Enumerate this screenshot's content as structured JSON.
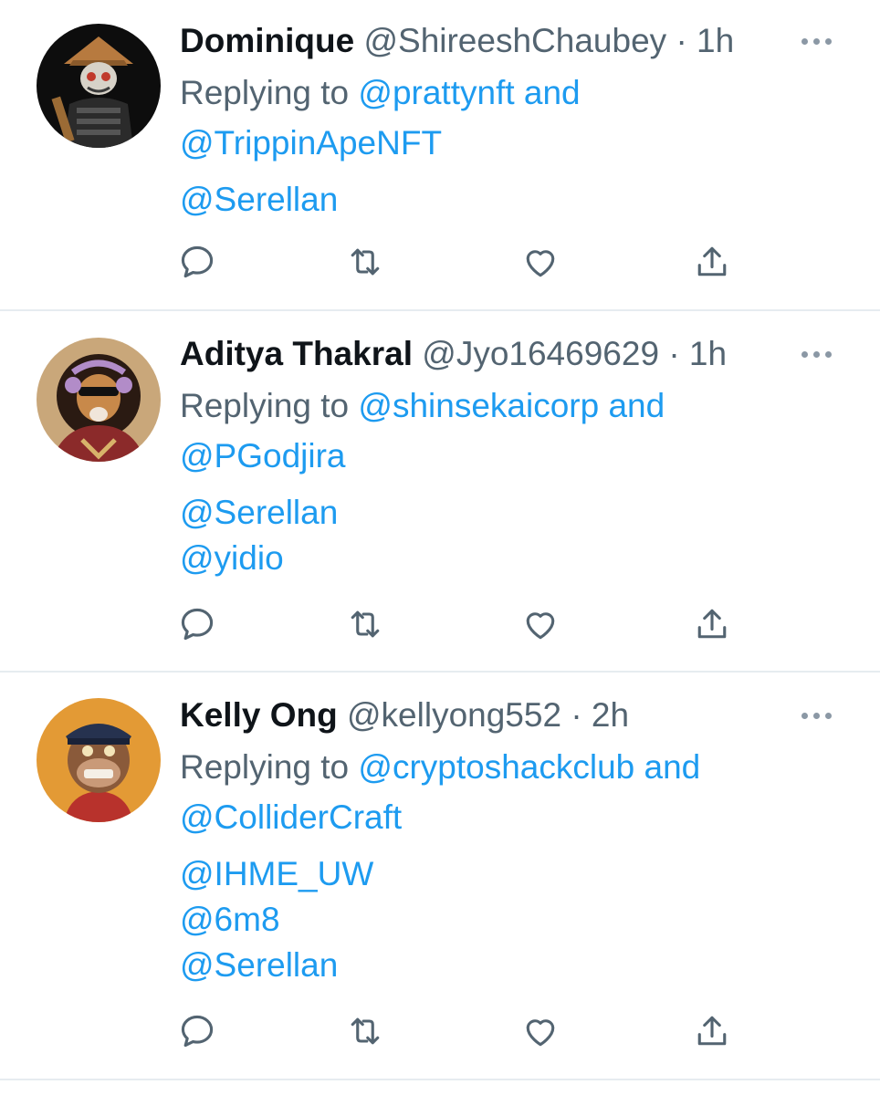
{
  "tweets": [
    {
      "display_name": "Dominique",
      "handle": "@ShireeshChaubey",
      "separator": "·",
      "time": "1h",
      "replying_prefix": "Replying to",
      "reply_to_1": "@prattynft",
      "reply_joiner": "and",
      "reply_to_2": "@TrippinApeNFT",
      "mentions": [
        "@Serellan"
      ],
      "avatar_icon": "samurai-avatar-icon"
    },
    {
      "display_name": "Aditya Thakral",
      "handle": "@Jyo16469629",
      "separator": "·",
      "time": "1h",
      "replying_prefix": "Replying to",
      "reply_to_1": "@shinsekaicorp",
      "reply_joiner": "and",
      "reply_to_2": "@PGodjira",
      "mentions": [
        "@Serellan",
        "@yidio"
      ],
      "avatar_icon": "lion-avatar-icon"
    },
    {
      "display_name": "Kelly Ong",
      "handle": "@kellyong552",
      "separator": "·",
      "time": "2h",
      "replying_prefix": "Replying to",
      "reply_to_1": "@cryptoshackclub",
      "reply_joiner": "and",
      "reply_to_2": "@ColliderCraft",
      "mentions": [
        "@IHME_UW",
        "@6m8",
        "@Serellan"
      ],
      "avatar_icon": "ape-avatar-icon"
    }
  ],
  "icons": {
    "reply": "reply-icon",
    "retweet": "retweet-icon",
    "like": "heart-icon",
    "share": "share-icon",
    "more": "more-icon"
  },
  "colors": {
    "link": "#1d9bf0",
    "secondary_text": "#536471",
    "primary_text": "#0f1419",
    "divider": "#e6ecf0",
    "icon": "#536471"
  }
}
